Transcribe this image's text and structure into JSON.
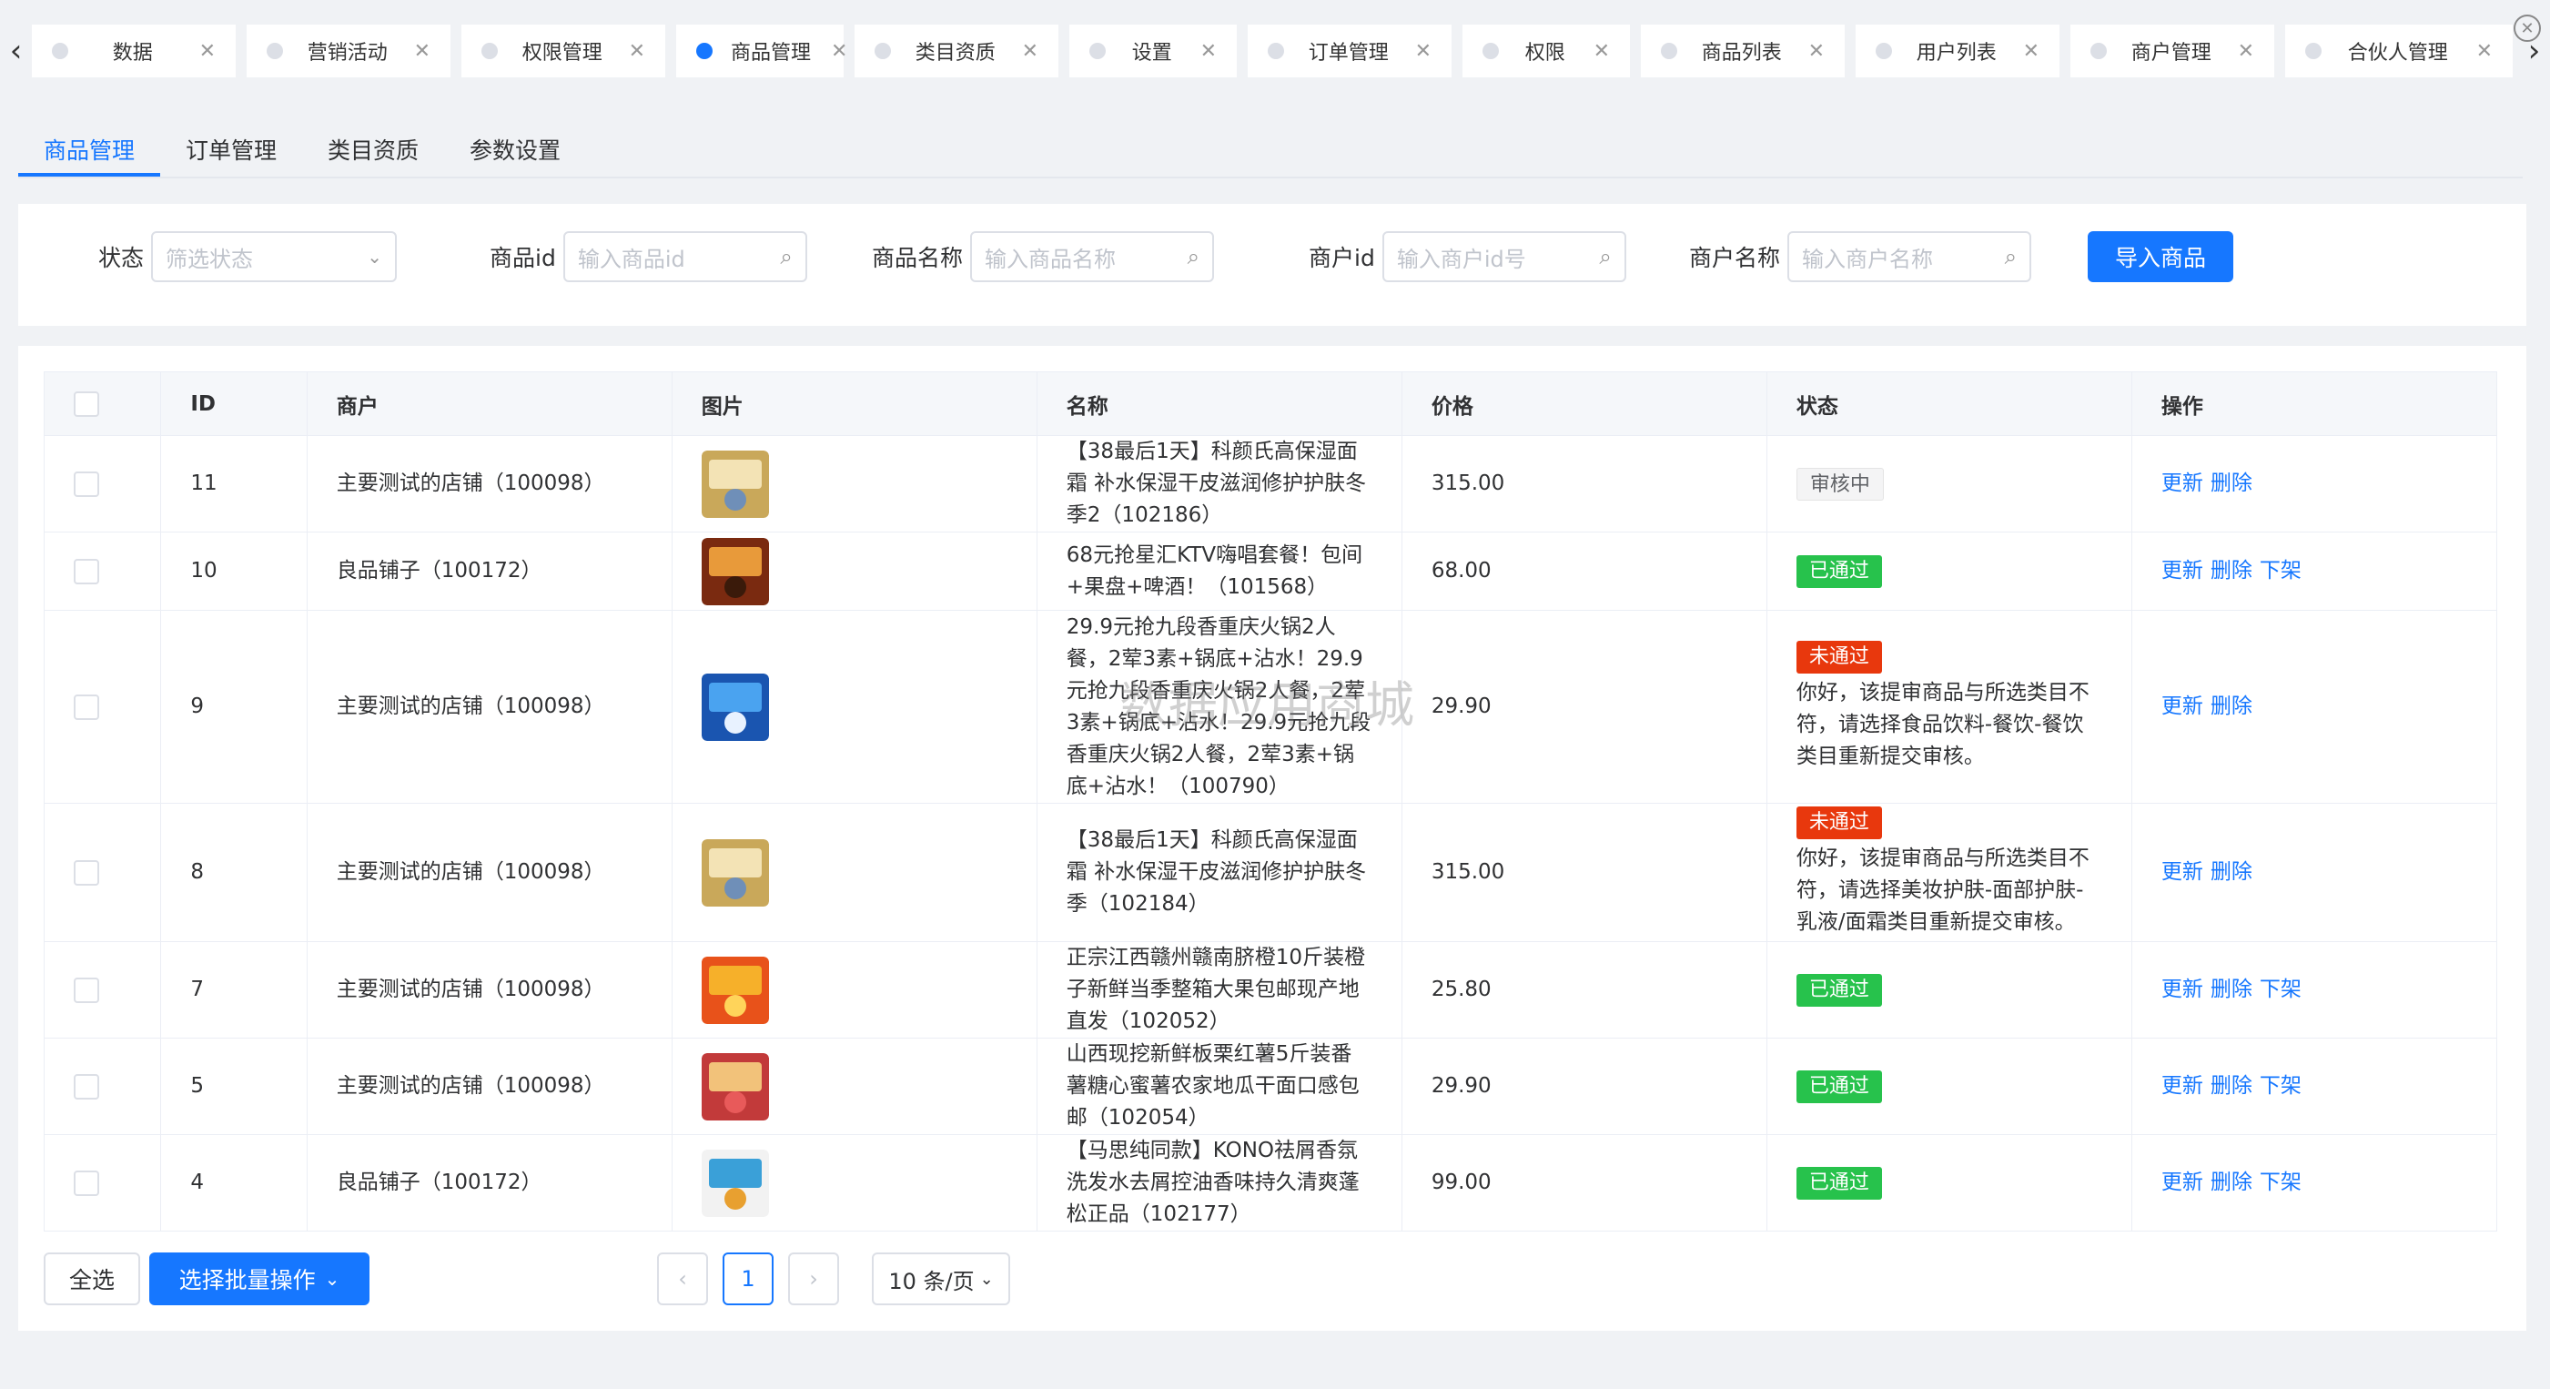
{
  "tabbar": {
    "tabs": [
      {
        "label": "数据",
        "active": false
      },
      {
        "label": "营销活动",
        "active": false
      },
      {
        "label": "权限管理",
        "active": false
      },
      {
        "label": "商品管理",
        "active": true
      },
      {
        "label": "类目资质",
        "active": false
      },
      {
        "label": "设置",
        "active": false
      },
      {
        "label": "订单管理",
        "active": false
      },
      {
        "label": "权限",
        "active": false
      },
      {
        "label": "商品列表",
        "active": false
      },
      {
        "label": "用户列表",
        "active": false
      },
      {
        "label": "商户管理",
        "active": false
      },
      {
        "label": "合伙人管理",
        "active": false
      }
    ]
  },
  "page_tabs": [
    "商品管理",
    "订单管理",
    "类目资质",
    "参数设置"
  ],
  "filters": {
    "status_label": "状态",
    "status_placeholder": "筛选状态",
    "goods_id_label": "商品id",
    "goods_id_placeholder": "输入商品id",
    "goods_name_label": "商品名称",
    "goods_name_placeholder": "输入商品名称",
    "merchant_id_label": "商户id",
    "merchant_id_placeholder": "输入商户id号",
    "merchant_name_label": "商户名称",
    "merchant_name_placeholder": "输入商户名称",
    "import_label": "导入商品"
  },
  "table": {
    "headers": [
      "ID",
      "商户",
      "图片",
      "名称",
      "价格",
      "状态",
      "操作"
    ],
    "rows": [
      {
        "id": "11",
        "merchant": "主要测试的店铺（100098）",
        "img": "cosmetic-image",
        "name": "【38最后1天】科颜氏高保湿面霜 补水保湿干皮滋润修护护肤冬季2（102186）",
        "price": "315.00",
        "status": "审核中",
        "status_type": "pending",
        "note": "",
        "ops": [
          "更新",
          "删除"
        ]
      },
      {
        "id": "10",
        "merchant": "良品铺子（100172）",
        "img": "ktv-image",
        "name": "68元抢星汇KTV嗨唱套餐！包间+果盘+啤酒！（101568）",
        "price": "68.00",
        "status": "已通过",
        "status_type": "pass",
        "note": "",
        "ops": [
          "更新",
          "删除",
          "下架"
        ]
      },
      {
        "id": "9",
        "merchant": "主要测试的店铺（100098）",
        "img": "hotpot-image",
        "name": "29.9元抢九段香重庆火锅2人餐，2荤3素+锅底+沾水！29.9元抢九段香重庆火锅2人餐，2荤3素+锅底+沾水！29.9元抢九段香重庆火锅2人餐，2荤3素+锅底+沾水！（100790）",
        "price": "29.90",
        "status": "未通过",
        "status_type": "fail",
        "note": "你好，该提审商品与所选类目不符，请选择食品饮料-餐饮-餐饮类目重新提交审核。",
        "ops": [
          "更新",
          "删除"
        ]
      },
      {
        "id": "8",
        "merchant": "主要测试的店铺（100098）",
        "img": "cosmetic-image",
        "name": "【38最后1天】科颜氏高保湿面霜 补水保湿干皮滋润修护护肤冬季（102184）",
        "price": "315.00",
        "status": "未通过",
        "status_type": "fail",
        "note": "你好，该提审商品与所选类目不符，请选择美妆护肤-面部护肤-乳液/面霜类目重新提交审核。",
        "ops": [
          "更新",
          "删除"
        ]
      },
      {
        "id": "7",
        "merchant": "主要测试的店铺（100098）",
        "img": "orange-image",
        "name": "正宗江西赣州赣南脐橙10斤装橙子新鲜当季整箱大果包邮现产地直发（102052）",
        "price": "25.80",
        "status": "已通过",
        "status_type": "pass",
        "note": "",
        "ops": [
          "更新",
          "删除",
          "下架"
        ]
      },
      {
        "id": "5",
        "merchant": "主要测试的店铺（100098）",
        "img": "sweet-potato-image",
        "name": "山西现挖新鲜板栗红薯5斤装番薯糖心蜜薯农家地瓜干面口感包邮（102054）",
        "price": "29.90",
        "status": "已通过",
        "status_type": "pass",
        "note": "",
        "ops": [
          "更新",
          "删除",
          "下架"
        ]
      },
      {
        "id": "4",
        "merchant": "良品铺子（100172）",
        "img": "shampoo-image",
        "name": "【马思纯同款】KONO祛屑香氛洗发水去屑控油香味持久清爽蓬松正品（102177）",
        "price": "99.00",
        "status": "已通过",
        "status_type": "pass",
        "note": "",
        "ops": [
          "更新",
          "删除",
          "下架"
        ]
      }
    ]
  },
  "pager": {
    "select_all": "全选",
    "batch": "选择批量操作",
    "page": "1",
    "page_size": "10 条/页"
  },
  "watermark": "数据应用商城"
}
